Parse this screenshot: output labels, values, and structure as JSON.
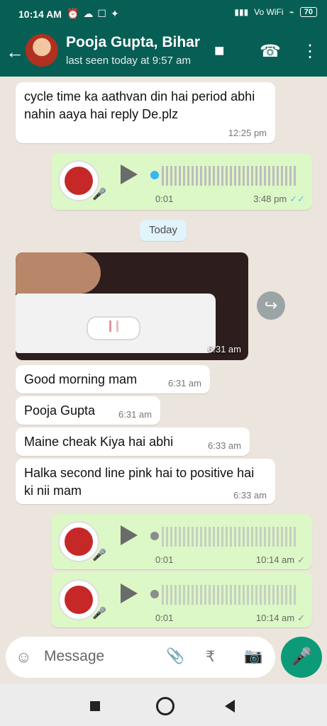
{
  "status_bar": {
    "time": "10:14 AM",
    "icons": [
      "alarm-off-icon",
      "cloud-icon",
      "notification-icon",
      "gallery-icon"
    ],
    "network": "Vo WiFi",
    "battery": "70"
  },
  "header": {
    "title": "Pooja Gupta, Bihar",
    "subtitle": "last seen today at 9:57 am",
    "back_icon": "arrow-left-icon",
    "video_icon": "video-call-icon",
    "phone_icon": "voice-call-icon",
    "menu_icon": "more-vert-icon"
  },
  "messages": {
    "m1": {
      "text": "cycle time ka aathvan din hai period abhi nahin aaya hai reply De.plz",
      "time": "12:25 pm"
    },
    "voice1": {
      "duration": "0:01",
      "time": "3:48 pm"
    },
    "date_label": "Today",
    "image": {
      "time": "6:31 am"
    },
    "m2": {
      "text": "Good morning mam",
      "time": "6:31 am"
    },
    "m3": {
      "text": "Pooja Gupta",
      "time": "6:31 am"
    },
    "m4": {
      "text": "Maine cheak Kiya hai abhi",
      "time": "6:33 am"
    },
    "m5": {
      "text": "Halka second line pink hai to positive hai ki nii mam",
      "time": "6:33 am"
    },
    "voice2": {
      "duration": "0:01",
      "time": "10:14 am"
    },
    "voice3": {
      "duration": "0:01",
      "time": "10:14 am"
    }
  },
  "composer": {
    "placeholder": "Message",
    "icons": [
      "emoji-icon",
      "attach-icon",
      "rupee-icon",
      "camera-icon",
      "mic-icon"
    ]
  },
  "nav": [
    "recent-apps-button",
    "home-button",
    "back-button"
  ]
}
